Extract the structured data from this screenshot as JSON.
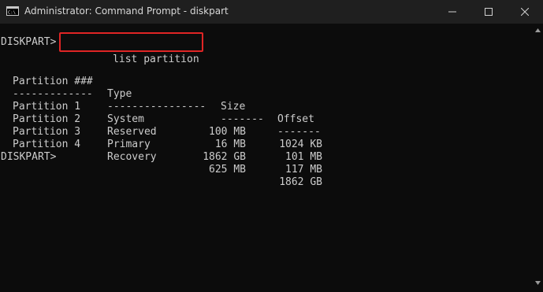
{
  "window": {
    "title": "Administrator: Command Prompt - diskpart"
  },
  "icons": {
    "app": "cmd-icon",
    "minimize": "minimize-icon",
    "maximize": "maximize-icon",
    "close": "close-icon"
  },
  "colors": {
    "console_bg": "#0c0c0c",
    "console_text": "#cccccc",
    "titlebar_bg": "#1f1f1f",
    "highlight_box": "#e02525"
  },
  "console": {
    "prompt": "DISKPART>",
    "command": "list partition",
    "table": {
      "headers": [
        "Partition ###",
        "Type",
        "Size",
        "Offset"
      ],
      "separators": [
        "-------------",
        "----------------",
        "-------",
        "-------"
      ],
      "rows": [
        [
          "Partition 1",
          "System",
          "100 MB",
          "1024 KB"
        ],
        [
          "Partition 2",
          "Reserved",
          "16 MB",
          "101 MB"
        ],
        [
          "Partition 3",
          "Primary",
          "1862 GB",
          "117 MB"
        ],
        [
          "Partition 4",
          "Recovery",
          "625 MB",
          "1862 GB"
        ]
      ]
    },
    "final_prompt": "DISKPART>"
  }
}
